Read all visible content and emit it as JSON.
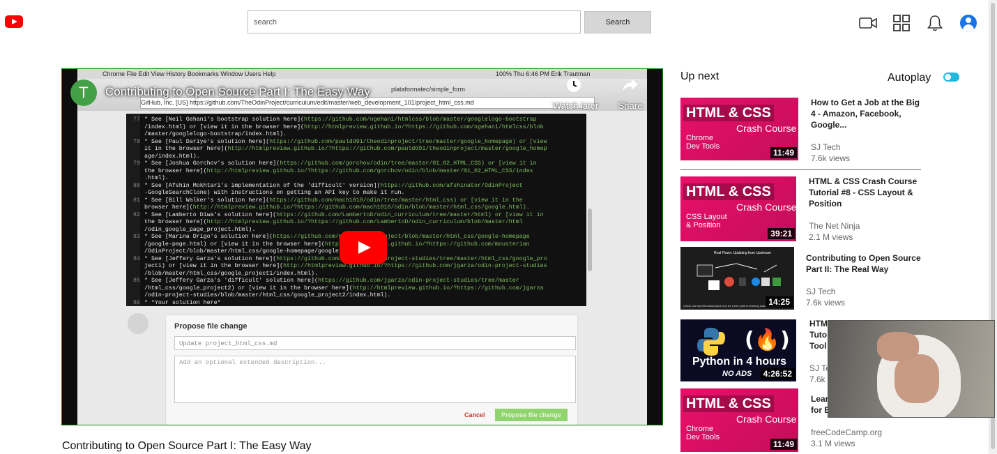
{
  "header": {
    "search_placeholder": "search",
    "search_button": "Search",
    "icons": [
      "youtube-logo-icon",
      "video-camera-icon",
      "apps-grid-icon",
      "bell-icon",
      "account-icon"
    ]
  },
  "player": {
    "channel_initial": "T",
    "overlay_title": "Contributing to Open Source Part I: The Easy Way",
    "watch_later": "Watch later",
    "share": "Share",
    "screen": {
      "menu": "Chrome   File   Edit   View   History   Bookmarks   Window   Users   Help",
      "menu_right": "100%   Thu 6:46 PM   Erik Trautman",
      "tab": "plataformatec/simple_form",
      "url": "GitHub, Inc. [US]  https://github.com/TheOdinProject/curriculum/edit/master/web_development_101/project_html_css.md",
      "code_lines": [
        {
          "n": "77",
          "a": "* See [Neil Gehani's bootstrap solution here](",
          "b": "https://github.com/ngehani/htmlcss/blob/master/googlelogo-bootstrap"
        },
        {
          "n": "",
          "a": "/index.html) or [view it in the browser here](",
          "b": "http://htmlpreview.github.io/?https://github.com/ngehani/htmlcss/blob"
        },
        {
          "n": "",
          "a": "/master/googlelogo-bootstrap/index.html).",
          "b": ""
        },
        {
          "n": "78",
          "a": "* See [Paul Dariye's solution here](",
          "b": "https://github.com/pauldd91/theodinproject/tree/master/google_homepage) or [view"
        },
        {
          "n": "",
          "a": "it in the browser here](",
          "b": "http://htmlpreview.github.io/?https://github.com/pauldd91/theodinproject/master/google_homep"
        },
        {
          "n": "",
          "a": "age/index.html).",
          "b": ""
        },
        {
          "n": "79",
          "a": "* See [Joshua Gorchov's solution here](",
          "b": "https://github.com/gorchov/odin/tree/master/01_02_HTML_CSS) or [view it in"
        },
        {
          "n": "",
          "a": "the browser here](",
          "b": "http://htmlpreview.github.io/?https://github.com/gorchov/odin/blob/master/01_02_HTML_CSS/index"
        },
        {
          "n": "",
          "a": ".html).",
          "b": ""
        },
        {
          "n": "80",
          "a": "* See [Afshin Mokhtari's implementation of the 'difficult' version](",
          "b": "https://github.com/afshinator/OdinProject"
        },
        {
          "n": "",
          "a": "-GoogleSearchClone) with instructions on getting an API key to make it run.",
          "b": ""
        },
        {
          "n": "81",
          "a": "* See [Bill Walker's solution here](",
          "b": "https://github.com/mach1010/odin/tree/master/html_css) or [view it in the"
        },
        {
          "n": "",
          "a": "browser here](",
          "b": "http://htmlpreview.github.io/?https://github.com/mach1010/odin/blob/master/html_css/google.html)."
        },
        {
          "n": "82",
          "a": "* See [Lamberto Diwa's solution here](",
          "b": "https://github.com/LambertoD/odin_curriculum/tree/master/html) or [view it in"
        },
        {
          "n": "",
          "a": "the browser here](",
          "b": "http://htmlpreview.github.io/?https://github.com/LambertoD/odin_curriculum/blob/master/html"
        },
        {
          "n": "",
          "a": "/odin_google_page_project.html).",
          "b": ""
        },
        {
          "n": "83",
          "a": "* See [Marina Drigo's solution here](",
          "b": "https://github.com/mdrigo/OdinProject/blob/master/html_css/google-homepage"
        },
        {
          "n": "",
          "a": "/google-page.html) or [view it in the browser here](",
          "b": "http://htmlpreview.github.io/?https://github.com/mousterian"
        },
        {
          "n": "",
          "a": "/OdinProject/blob/master/html_css/google-homepage/google-page.html).",
          "b": ""
        },
        {
          "n": "84",
          "a": "* See [Jeffery Garza's solution here](",
          "b": "https://github.com/jgarza/odin-project-studies/tree/master/html_css/google_pro"
        },
        {
          "n": "",
          "a": "ject1) or [view it in the browser here](",
          "b": "http://htmlpreview.github.io/?https://github.com/jgarza/odin-project-studies"
        },
        {
          "n": "",
          "a": "/blob/master/html_css/google_project1/index.html).",
          "b": ""
        },
        {
          "n": "85",
          "a": "* See [Jeffery Garza's 'difficult' solution here](",
          "b": "https://github.com/jgarza/odin-project-studies/tree/master"
        },
        {
          "n": "",
          "a": "/html_css/google_project2) or [view it in the browser here](",
          "b": "http://htmlpreview.github.io/?https://github.com/jgarza"
        },
        {
          "n": "",
          "a": "/odin-project-studies/blob/master/html_css/google_project2/index.html).",
          "b": ""
        },
        {
          "n": "86",
          "a": "* *Your solution here*",
          "b": ""
        }
      ],
      "propose_title": "Propose file change",
      "propose_input": "Update project_html_css.md",
      "propose_textarea": "Add an optional extended description...",
      "cancel": "Cancel",
      "propose_button": "Propose file change"
    }
  },
  "main_title": "Contributing to Open Source Part I: The Easy Way",
  "sidebar": {
    "up_next": "Up next",
    "autoplay": "Autoplay",
    "autoplay_on": true,
    "videos": [
      {
        "title": "How to Get a Job at the Big 4 - Amazon, Facebook, Google...",
        "channel": "SJ Tech",
        "views": "7.6k views",
        "duration": "11:49",
        "thumb": {
          "big": "HTML & CSS",
          "crash": "Crash Course",
          "sub": "Chrome\nDev Tools"
        }
      },
      {
        "title": "HTML & CSS Crash Course Tutorial #8 - CSS Layout & Position",
        "channel": "The Net Ninja",
        "views": "2.1 M views",
        "duration": "39:21",
        "thumb": {
          "big": "HTML & CSS",
          "crash": "Crash Course",
          "sub": "CSS Layout\n& Position"
        }
      },
      {
        "title": "Contributing to Open Source Part II: The Real Way",
        "channel": "SJ Tech",
        "views": "7.6k views",
        "duration": "14:25",
        "thumb": {
          "top": "Real Flows: Updating from Upstream",
          "bottom": "Check out http://theodinproject.com for a free path to learning www.devopsjobs..."
        }
      },
      {
        "title": "HTML & CSS Crash Course Tutorial #1 - Dev Tool",
        "title_visible": "HTM\nTuto\nTool",
        "channel": "SJ Te",
        "views": "7.6k",
        "duration": "4:26:52",
        "thumb": {
          "text": "Python in 4 hours",
          "noads": "NO ADS"
        }
      },
      {
        "title_visible": "Lear\nfor B",
        "channel": "freeCodeCamp.org",
        "views": "3.1 M views",
        "duration": "11:49",
        "thumb": {
          "big": "HTML & CSS",
          "crash": "Crash Course",
          "sub": "Chrome\nDev Tools"
        }
      }
    ]
  },
  "colors": {
    "brand_red": "#ff0000",
    "toggle": "#1fb9e0",
    "thumb_pink": "#e8106a",
    "player_border": "#138a13"
  }
}
